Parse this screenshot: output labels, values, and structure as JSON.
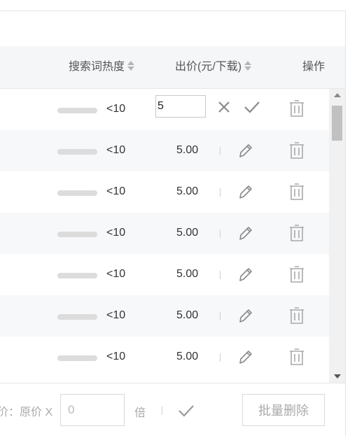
{
  "table": {
    "headers": {
      "heat": "搜索词热度",
      "price": "出价(元/下载)",
      "action": "操作"
    },
    "editing_row": {
      "heat": "<10",
      "price_input_value": "5"
    },
    "rows": [
      {
        "heat": "<10",
        "price": "5.00"
      },
      {
        "heat": "<10",
        "price": "5.00"
      },
      {
        "heat": "<10",
        "price": "5.00"
      },
      {
        "heat": "<10",
        "price": "5.00"
      },
      {
        "heat": "<10",
        "price": "5.00"
      },
      {
        "heat": "<10",
        "price": "5.00"
      }
    ]
  },
  "footer": {
    "label": "价：原价 X",
    "multiplier_value": "0",
    "times_label": "倍",
    "batch_delete_label": "批量删除"
  },
  "icons": {
    "sort": "sort-arrows-icon",
    "cancel": "close-icon",
    "confirm": "check-icon",
    "edit": "pencil-icon",
    "delete": "trash-icon"
  },
  "colors": {
    "header_bg": "#f5f6f8",
    "row_alt_bg": "#f7f8fa",
    "icon_gray": "#a8a8a8"
  }
}
